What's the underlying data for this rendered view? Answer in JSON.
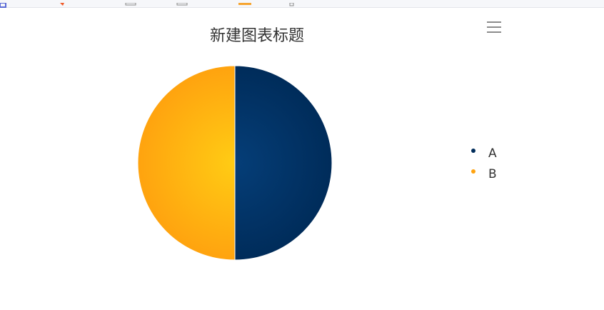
{
  "toolbar": {
    "icons": [
      "window-icon",
      "pen-icon",
      "document-icon",
      "copy-icon",
      "folder-icon",
      "file-icon"
    ]
  },
  "chart_data": {
    "type": "pie",
    "title": "新建图表标题",
    "slices": [
      {
        "name": "A",
        "value": 50,
        "color": "#002c5a"
      },
      {
        "name": "B",
        "value": 50,
        "color": "#ffa30f"
      }
    ],
    "legend_position": "right"
  },
  "menu": {
    "icon": "hamburger-menu-icon"
  }
}
